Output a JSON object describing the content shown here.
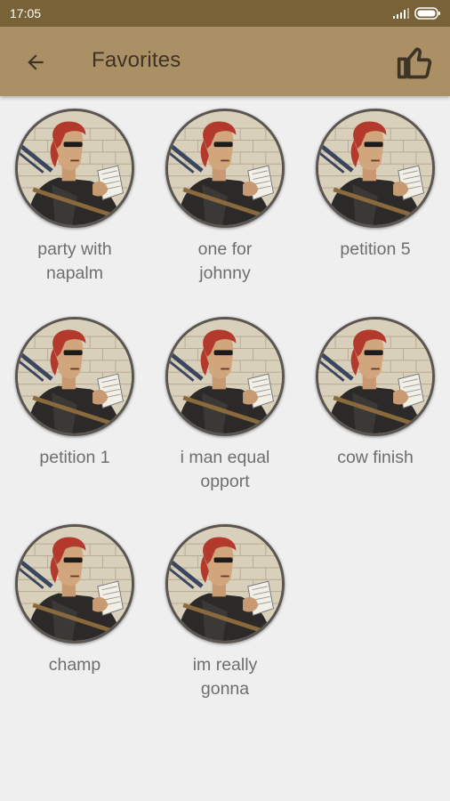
{
  "status_bar": {
    "time": "17:05"
  },
  "app_bar": {
    "title": "Favorites",
    "back_icon": "arrow-back-icon",
    "like_icon": "thumbs-up-icon"
  },
  "colors": {
    "status_bar": "#7a6238",
    "app_bar": "#ab8f65",
    "background": "#efefef",
    "label_text": "#6e6e6e"
  },
  "favorites": [
    {
      "label": "party with\nnapalm"
    },
    {
      "label": "one for\njohnny"
    },
    {
      "label": "petition 5"
    },
    {
      "label": "petition 1"
    },
    {
      "label": "i man equal\nopport"
    },
    {
      "label": "cow finish"
    },
    {
      "label": "champ"
    },
    {
      "label": "im really\ngonna"
    }
  ]
}
